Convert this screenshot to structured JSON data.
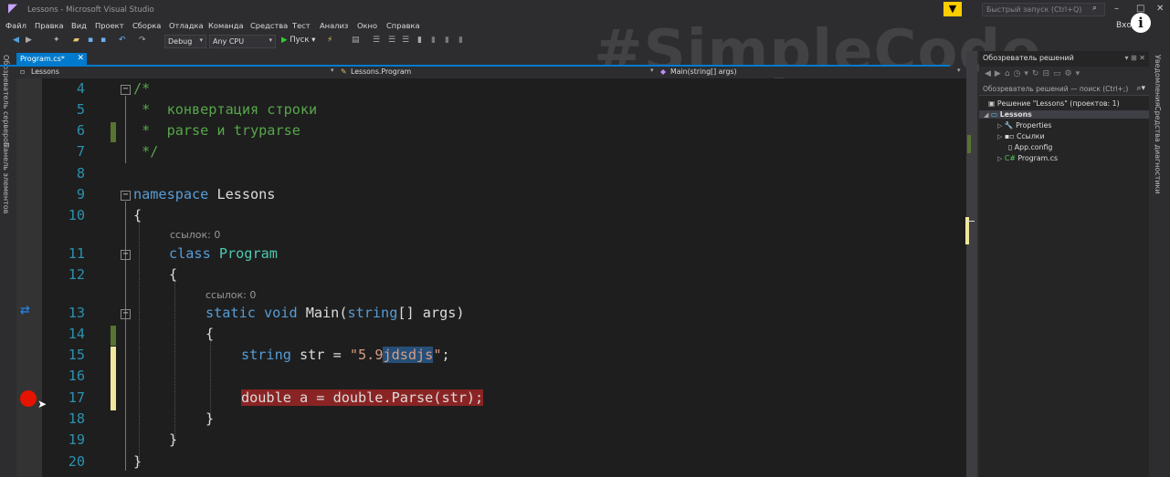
{
  "window": {
    "title": "Lessons - Microsoft Visual Studio",
    "quick_launch_placeholder": "Быстрый запуск (Ctrl+Q)",
    "sign_in": "Вход",
    "minimize": "–",
    "restore": "□",
    "close": "✕"
  },
  "menu": [
    "Файл",
    "Правка",
    "Вид",
    "Проект",
    "Сборка",
    "Отладка",
    "Команда",
    "Средства",
    "Тест",
    "Анализ",
    "Окно",
    "Справка"
  ],
  "toolbar": {
    "config": "Debug",
    "platform": "Any CPU",
    "run": "Пуск"
  },
  "left_rail": [
    "Обозреватель серверов",
    "Панель элементов"
  ],
  "tabs": [
    {
      "label": "Program.cs*",
      "close": "✕"
    }
  ],
  "navbar": {
    "project": "Lessons",
    "class": "Lessons.Program",
    "member": "Main(string[] args)"
  },
  "editor": {
    "line_numbers": [
      "4",
      "5",
      "6",
      "7",
      "8",
      "9",
      "10",
      "11",
      "12",
      "13",
      "14",
      "15",
      "16",
      "17",
      "18",
      "19",
      "20"
    ],
    "code": {
      "l4": "/*",
      "l5": " *  конвертация строки",
      "l6": " *  parse и tryparse",
      "l7": " */",
      "l9_kw": "namespace",
      "l9_name": " Lessons",
      "l10": "{",
      "lens1": "ссылок: 0",
      "l11_kw": "class",
      "l11_name": "Program",
      "l12": "{",
      "lens2": "ссылок: 0",
      "l13_kw1": "static",
      "l13_kw2": "void",
      "l13_name": " Main(",
      "l13_kw3": "string",
      "l13_rest": "[] args)",
      "l14": "{",
      "l15_kw": "string",
      "l15_mid": " str = ",
      "l15_str1": "\"5.9",
      "l15_sel": "jdsdjs",
      "l15_str2": "\"",
      "l15_end": ";",
      "l17": "double a = double.Parse(str);",
      "l18": "}",
      "l19": "}",
      "l20": "}"
    }
  },
  "watermark": "#SimpleCode",
  "solution_explorer": {
    "title": "Обозреватель решений",
    "search_placeholder": "Обозреватель решений — поиск (Ctrl+;)",
    "solution": "Решение \"Lessons\"  (проектов: 1)",
    "project": "Lessons",
    "items": [
      "Properties",
      "Ссылки",
      "App.config",
      "Program.cs"
    ]
  },
  "right_rail": [
    "Уведомления",
    "Средства диагностики"
  ],
  "colors": {
    "accent": "#007acc",
    "breakpoint": "#e51400",
    "breakpoint_line": "#8a2424",
    "keyword": "#569cd6",
    "type": "#4ec9b0",
    "string": "#d69d85",
    "comment": "#57a64a",
    "line_number": "#2b91af"
  }
}
